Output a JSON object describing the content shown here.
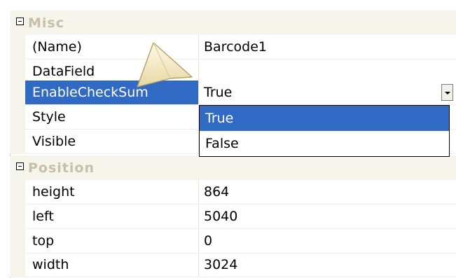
{
  "property_grid": {
    "categories": [
      {
        "label": "Misc",
        "rows": [
          {
            "name": "(Name)",
            "value": "Barcode1"
          },
          {
            "name": "DataField",
            "value": ""
          },
          {
            "name": "EnableCheckSum",
            "value": "True",
            "selected": true
          },
          {
            "name": "Style",
            "value": ""
          },
          {
            "name": "Visible",
            "value": ""
          }
        ]
      },
      {
        "label": "Position",
        "rows": [
          {
            "name": "height",
            "value": "864"
          },
          {
            "name": "left",
            "value": "5040"
          },
          {
            "name": "top",
            "value": "0"
          },
          {
            "name": "width",
            "value": "3024"
          }
        ]
      }
    ],
    "dropdown": {
      "options": [
        "True",
        "False"
      ],
      "highlighted": "True"
    }
  },
  "icons": {
    "category_toggle": "collapse-minus-icon",
    "dropdown_button": "chevron-down-icon",
    "pointer": "arrow-cursor-icon"
  },
  "colors": {
    "selection": "#316ac5",
    "category_text": "#c7c0a6",
    "gutter": "#f6f5ec"
  }
}
